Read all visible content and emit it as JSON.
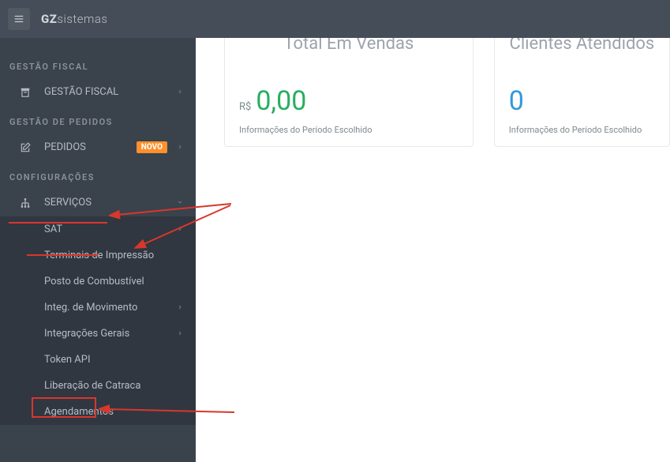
{
  "brand": {
    "bold": "GZ",
    "light": "sistemas"
  },
  "sidebar": {
    "fiscal_header": "GESTÃO FISCAL",
    "fiscal_item": "GESTÃO FISCAL",
    "pedidos_header": "GESTÃO DE PEDIDOS",
    "pedidos_item": "PEDIDOS",
    "pedidos_badge": "NOVO",
    "config_header": "CONFIGURAÇÕES",
    "servicos_item": "SERVIÇOS",
    "submenu": {
      "sat": "SAT",
      "terminais": "Terminais de Impressão",
      "posto": "Posto de Combustível",
      "integ_mov": "Integ. de Movimento",
      "integ_gerais": "Integrações Gerais",
      "token": "Token API",
      "liberacao": "Liberação de Catraca",
      "agendamentos": "Agendamentos"
    }
  },
  "cards": {
    "sales": {
      "title": "Total Em Vendas",
      "currency": "R$",
      "value": "0,00",
      "sub": "Informações do Período Escolhido"
    },
    "clients": {
      "title": "Clientes Atendidos",
      "value": "0",
      "sub": "Informações do Período Escolhido"
    }
  }
}
